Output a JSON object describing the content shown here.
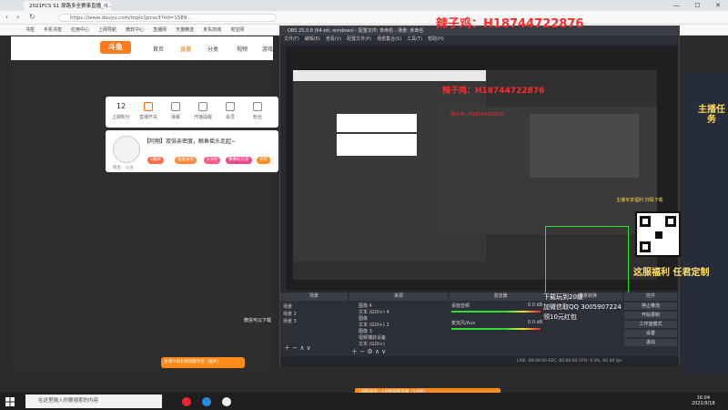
{
  "browser": {
    "tab_title": "2021FCS S1 周路多全赛事直播_斗…",
    "url": "https://www.douyu.com/topic/jpcss3?rid=1589…",
    "bookmarks": [
      "书签",
      "手机书签",
      "应用中心",
      "上网导航",
      "微软中心",
      "直播网",
      "天猫精选",
      "京东商城",
      "淘宝网"
    ],
    "nav": [
      "首页",
      "直播",
      "分类",
      "视频",
      "游戏"
    ],
    "panel": {
      "count": "12",
      "items": [
        "上期积分",
        "直播开关",
        "弹幕",
        "开播提醒",
        "会员",
        "粉丝"
      ]
    },
    "card": {
      "title": "【阿翔】双倍亲密度，鲸鱼摇头走起~",
      "tags": [
        "鲸鱼",
        "公主"
      ],
      "pills": [
        "1翻牌",
        "福星高照",
        "1小时",
        "赛事的兄弟",
        "星粉"
      ]
    },
    "hint": "微信可以下载",
    "promo_banner": "主播今日礼物领取专区（福利）",
    "bottom_banner": "1累积观看一1到到观看直播（5/8名）"
  },
  "obs": {
    "title": "OBS 25.0.8 (64-bit, windows) - 配置文件: 未命名 - 场景: 未命名",
    "menu": [
      "文件(F)",
      "编辑(E)",
      "查看(V)",
      "配置文件(P)",
      "场景集合(S)",
      "工具(T)",
      "帮助(H)"
    ],
    "signature": "辣子鸡：H18744722876",
    "signature_small": "辣子鸡：H18744722876",
    "signature_tiny": "辣子鸡：H18744722876",
    "docks": {
      "scenes": "场景",
      "sources": "来源",
      "mixer": "混音器",
      "transitions": "场景转换",
      "controls": "控件"
    },
    "scenes": [
      "场景",
      "场景 2",
      "场景 3"
    ],
    "sources": [
      "图像 4",
      "文本 (GDI+) 4",
      "图像",
      "文本 (GDI+) 2",
      "图像 3",
      "视频捕获设备",
      "文本 (GDI+)"
    ],
    "mixer": [
      {
        "name": "桌面音频",
        "level": "0.0 dB"
      },
      {
        "name": "麦克风/Aux",
        "level": "0.0 dB"
      }
    ],
    "controls": [
      "停止推流",
      "开始录制",
      "工作室模式",
      "设置",
      "退出"
    ],
    "status": "LIVE: 00:00:00  REC: 00:00:00  CPU: 0.4%, 60.00 fps"
  },
  "overlay": {
    "lines": [
      "下载玩到20级",
      "加微信取QQ 3005907224",
      "领10元红包"
    ],
    "promo": "主播任务",
    "qr_caption": "主播专享福利 扫码下载",
    "promo2": "这服福利 任君定制"
  },
  "taskbar": {
    "search_placeholder": "在这里输入你要搜索的内容",
    "time": "16:04",
    "date": "2021/9/18"
  }
}
